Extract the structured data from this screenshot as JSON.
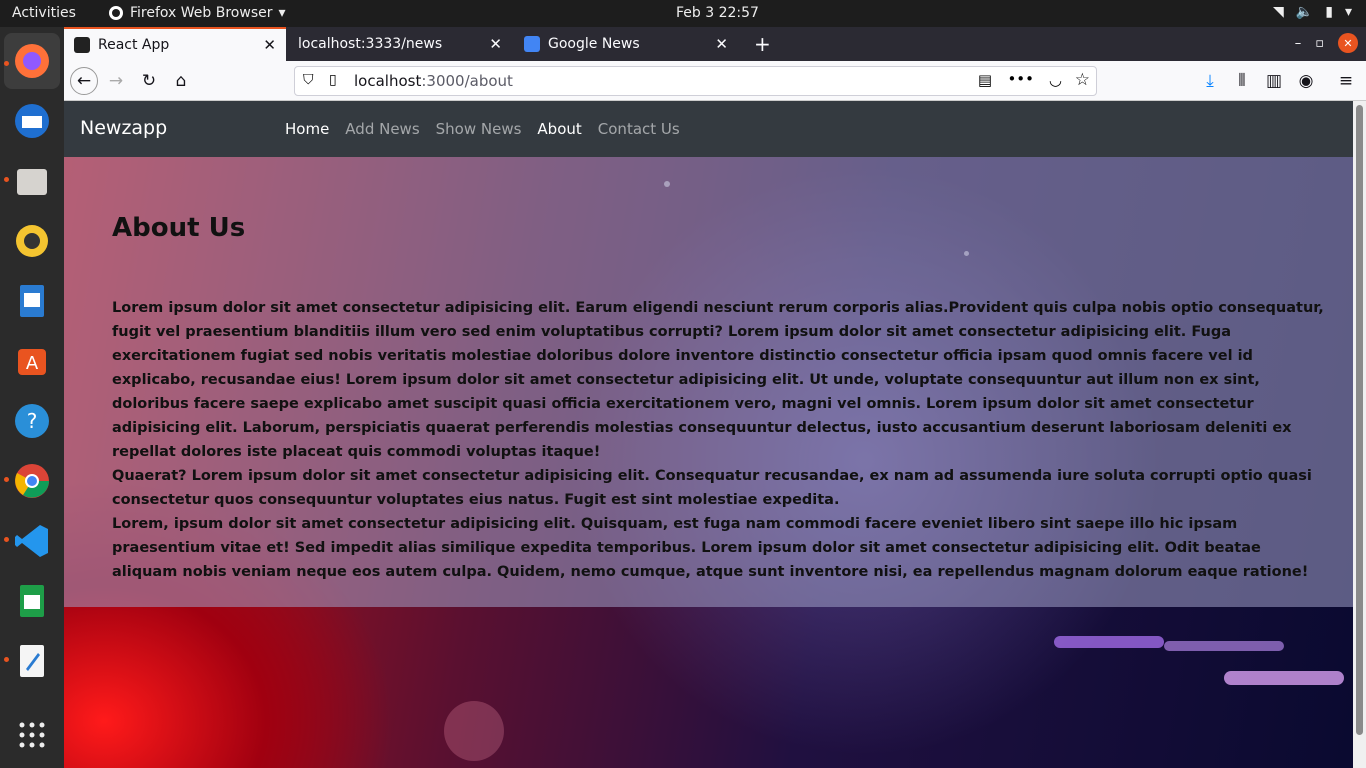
{
  "topbar": {
    "activities": "Activities",
    "app_name": "Firefox Web Browser",
    "clock": "Feb 3  22:57"
  },
  "browser": {
    "tabs": [
      {
        "title": "React App",
        "active": true
      },
      {
        "title": "localhost:3333/news",
        "active": false
      },
      {
        "title": "Google News",
        "active": false
      }
    ],
    "url_host": "localhost",
    "url_rest": ":3000/about"
  },
  "site": {
    "brand": "Newzapp",
    "menu": [
      "Home",
      "Add News",
      "Show News",
      "About",
      "Contact Us"
    ],
    "heading": "About Us",
    "paragraphs": [
      "Lorem ipsum dolor sit amet consectetur adipisicing elit. Earum eligendi nesciunt rerum corporis alias.Provident quis culpa nobis optio consequatur, fugit vel praesentium blanditiis illum vero sed enim voluptatibus corrupti? Lorem ipsum dolor sit amet consectetur adipisicing elit. Fuga exercitationem fugiat sed nobis veritatis molestiae doloribus dolore inventore distinctio consectetur officia ipsam quod omnis facere vel id explicabo, recusandae eius! Lorem ipsum dolor sit amet consectetur adipisicing elit. Ut unde, voluptate consequuntur aut illum non ex sint, doloribus facere saepe explicabo amet suscipit quasi officia exercitationem vero, magni vel omnis. Lorem ipsum dolor sit amet consectetur adipisicing elit. Laborum, perspiciatis quaerat perferendis molestias consequuntur delectus, iusto accusantium deserunt laboriosam deleniti ex repellat dolores iste placeat quis commodi voluptas itaque!",
      "Quaerat? Lorem ipsum dolor sit amet consectetur adipisicing elit. Consequatur recusandae, ex nam ad assumenda iure soluta corrupti optio quasi consectetur quos consequuntur voluptates eius natus. Fugit est sint molestiae expedita.",
      "Lorem, ipsum dolor sit amet consectetur adipisicing elit. Quisquam, est fuga nam commodi facere eveniet libero sint saepe illo hic ipsam praesentium vitae et! Sed impedit alias similique expedita temporibus. Lorem ipsum dolor sit amet consectetur adipisicing elit. Odit beatae aliquam nobis veniam neque eos autem culpa. Quidem, nemo cumque, atque sunt inventore nisi, ea repellendus magnam dolorum eaque ratione!"
    ]
  },
  "colors": {
    "accent": "#e95420",
    "site_nav_bg": "#343a40"
  }
}
